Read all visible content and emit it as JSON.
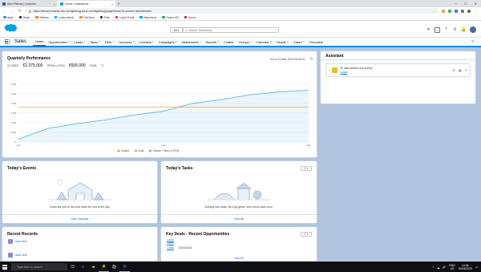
{
  "browser": {
    "tabs": [
      {
        "label": "Alex Palmer | LinkedIn",
        "favicon_color": "#0a66c2",
        "active": false
      },
      {
        "label": "Home | Salesforce",
        "favicon_color": "#00a1e0",
        "active": true
      }
    ],
    "new_tab": "+",
    "url": "https://devext-liuchia-dev-ed.lightning.force.com/lightning/page/home?0.source=alohaHeader",
    "bookmarks": [
      {
        "label": "Apps",
        "color": "#4285f4"
      },
      {
        "label": "Slack",
        "color": "#4a154b"
      },
      {
        "label": "Tableau",
        "color": "#e97627"
      },
      {
        "label": "Lucke Admin",
        "color": "#00a1e0"
      },
      {
        "label": "HubSpot",
        "color": "#ff7a59"
      },
      {
        "label": "Tilda",
        "color": "#333333"
      },
      {
        "label": "Lucke Email",
        "color": "#d93025"
      },
      {
        "label": "Salesforce",
        "color": "#00a1e0"
      },
      {
        "label": "Devon HR",
        "color": "#34a853"
      },
      {
        "label": "Quora",
        "color": "#b92b27"
      }
    ]
  },
  "sf": {
    "scope_label": "All",
    "search_placeholder": "Search Salesforce",
    "app_name": "Sales",
    "nav": [
      {
        "label": "Home",
        "active": true,
        "has_menu": false
      },
      {
        "label": "Opportunities",
        "active": false,
        "has_menu": true
      },
      {
        "label": "Leads",
        "active": false,
        "has_menu": true
      },
      {
        "label": "Tasks",
        "active": false,
        "has_menu": true
      },
      {
        "label": "Files",
        "active": false,
        "has_menu": true
      },
      {
        "label": "Accounts",
        "active": false,
        "has_menu": true
      },
      {
        "label": "Contacts",
        "active": false,
        "has_menu": true
      },
      {
        "label": "Campaigns",
        "active": false,
        "has_menu": true
      },
      {
        "label": "Dashboards",
        "active": false,
        "has_menu": true
      },
      {
        "label": "Reports",
        "active": false,
        "has_menu": true
      },
      {
        "label": "Chatter",
        "active": false,
        "has_menu": false
      },
      {
        "label": "Groups",
        "active": false,
        "has_menu": true
      },
      {
        "label": "Calendar",
        "active": false,
        "has_menu": true
      },
      {
        "label": "People",
        "active": false,
        "has_menu": true
      },
      {
        "label": "Cases",
        "active": false,
        "has_menu": true
      },
      {
        "label": "Forecasts",
        "active": false,
        "has_menu": false
      }
    ]
  },
  "performance": {
    "title": "Quarterly Performance",
    "closed_label": "CLOSED",
    "closed_value": "€2,375,000",
    "open_label": "OPEN (>70%)",
    "open_value": "€665,000",
    "goal_label": "GOAL",
    "as_of": "As of 21-Mar-2019 09:06:21"
  },
  "chart_data": {
    "type": "line",
    "x_ticks": [
      "Jan",
      "Feb",
      "Mar"
    ],
    "y_ticks": [
      "0",
      "500k",
      "1.0M",
      "1.5M",
      "2.0M",
      "2.5M",
      "3.0M"
    ],
    "ylim": [
      0,
      3200000
    ],
    "x": [
      0,
      0.1,
      0.2,
      0.3,
      0.4,
      0.5,
      0.6,
      0.7,
      0.8,
      0.9,
      1.0
    ],
    "series": [
      {
        "name": "Closed",
        "color": "#f59331",
        "values": [
          1800000,
          1800000,
          1800000,
          1800000,
          1800000,
          1800000,
          1800000,
          1800000,
          1800000,
          1800000,
          1800000
        ]
      },
      {
        "name": "Goal",
        "color": "#9ec73d",
        "values": []
      },
      {
        "name": "Closed + Open (>70%)",
        "color": "#5bb7e4",
        "values": [
          150000,
          700000,
          950000,
          1150000,
          1400000,
          1600000,
          2000000,
          2200000,
          2450000,
          2600000,
          2680000
        ]
      }
    ]
  },
  "assistant": {
    "title": "Assistant",
    "item_text": "30 days without any activity",
    "item_link": "Lucas"
  },
  "events": {
    "title": "Today's Events",
    "empty_text": "Looks like you're free and clear the rest of the day.",
    "view_link": "View Calendar"
  },
  "tasks": {
    "title": "Today's Tasks",
    "empty_text": "Nothing due today. Be a go-getter, and check back soon.",
    "view_link": "View All",
    "filter_caret": "▾"
  },
  "records": {
    "title": "Recent Records",
    "items": [
      "acme test",
      "acme test"
    ]
  },
  "deals": {
    "title": "Key Deals - Recent Opportunities",
    "rows": [
      {
        "name": "Lucas",
        "sub": "Lucas"
      },
      {
        "name": "Lucas",
        "sub": "31/03/2019"
      }
    ],
    "view_link": "View All"
  },
  "taskbar": {
    "search_placeholder": "Type here to search",
    "lang": "ENG",
    "region": "UK",
    "time": "14:46",
    "date": "20/03/2019"
  }
}
